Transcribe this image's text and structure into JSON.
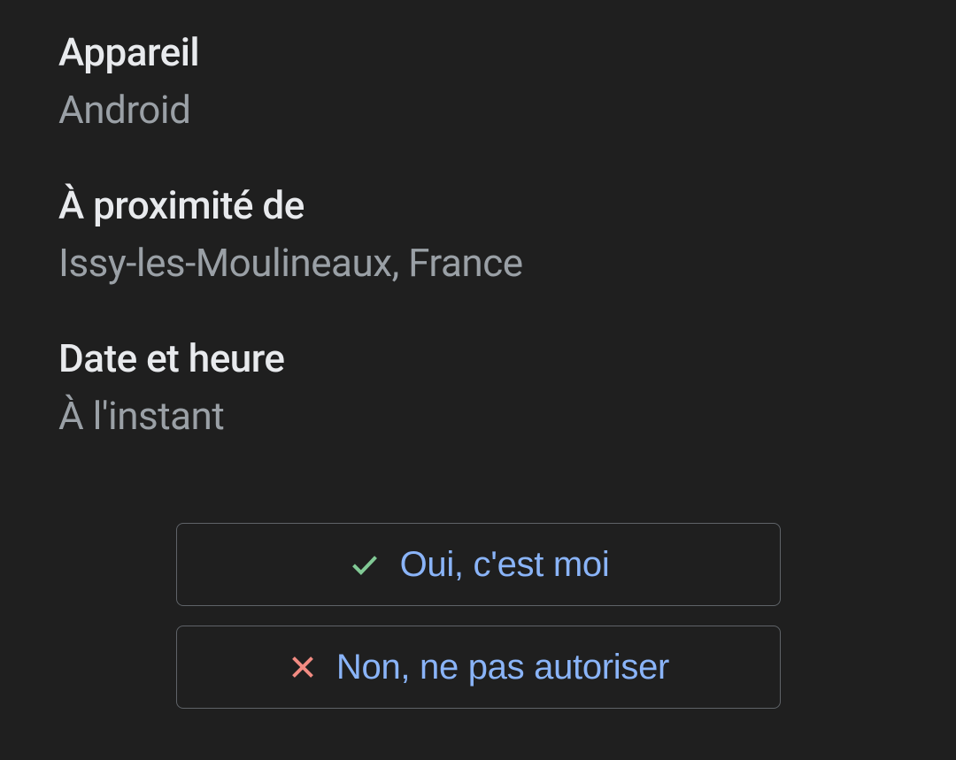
{
  "sections": {
    "device": {
      "label": "Appareil",
      "value": "Android"
    },
    "location": {
      "label": "À proximité de",
      "value": "Issy-les-Moulineaux, France"
    },
    "datetime": {
      "label": "Date et heure",
      "value": "À l'instant"
    }
  },
  "buttons": {
    "confirm": {
      "label": "Oui, c'est moi"
    },
    "deny": {
      "label": "Non, ne pas autoriser"
    }
  }
}
